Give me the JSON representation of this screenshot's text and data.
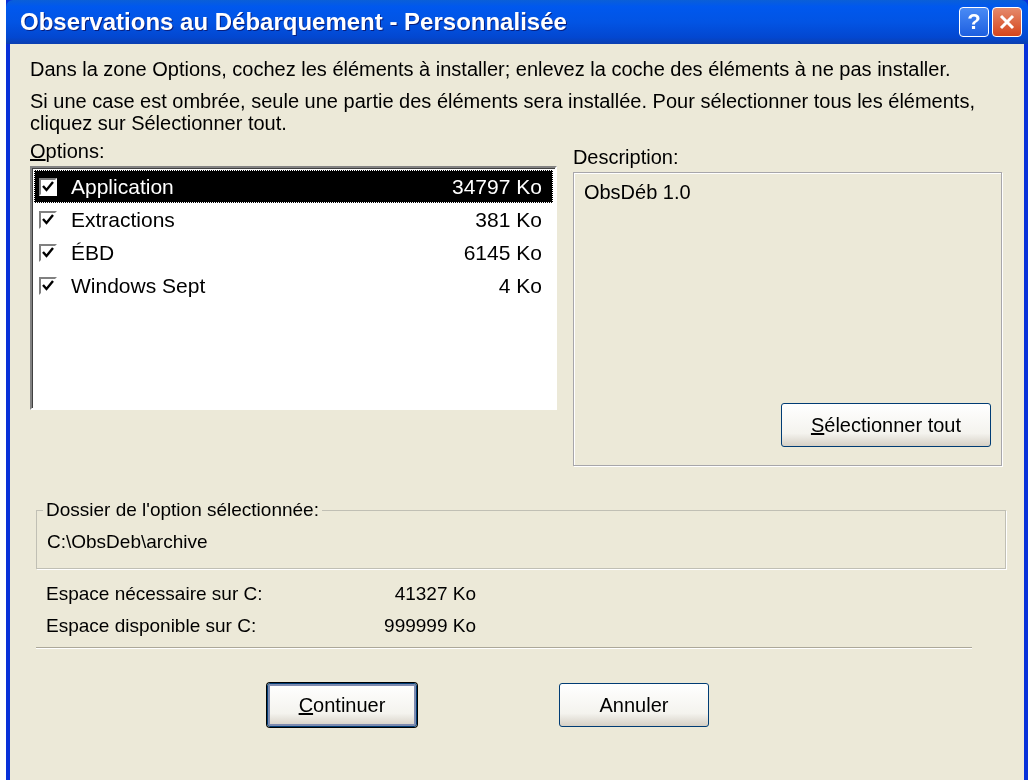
{
  "window": {
    "title": "Observations au Débarquement - Personnalisée",
    "help_label": "?"
  },
  "instructions": [
    "Dans la zone Options, cochez les éléments à installer; enlevez la coche des éléments à ne pas installer.",
    "Si une case est ombrée, seule une partie des éléments sera installée. Pour sélectionner tous les éléments, cliquez sur Sélectionner tout."
  ],
  "options": {
    "label": "Options:",
    "underline_first": true,
    "items": [
      {
        "name": "Application",
        "size": "34797 Ko",
        "checked": true,
        "selected": true
      },
      {
        "name": "Extractions",
        "size": "381 Ko",
        "checked": true,
        "selected": false
      },
      {
        "name": "ÉBD",
        "size": "6145 Ko",
        "checked": true,
        "selected": false
      },
      {
        "name": "Windows Sept",
        "size": "4 Ko",
        "checked": true,
        "selected": false
      }
    ]
  },
  "description": {
    "label": "Description:",
    "text": "ObsDéb 1.0",
    "button": {
      "label": "Sélectionner tout",
      "underline_first": true
    }
  },
  "folder": {
    "label": "Dossier de l'option sélectionnée:",
    "path": "C:\\ObsDeb\\archive"
  },
  "space": [
    {
      "label": "Espace nécessaire sur C:",
      "value": "41327 Ko"
    },
    {
      "label": "Espace disponible sur C:",
      "value": "999999 Ko"
    }
  ],
  "buttons": [
    {
      "label": "Continuer",
      "default": true,
      "underline_first": true
    },
    {
      "label": "Annuler",
      "default": false,
      "underline_first": false
    }
  ]
}
